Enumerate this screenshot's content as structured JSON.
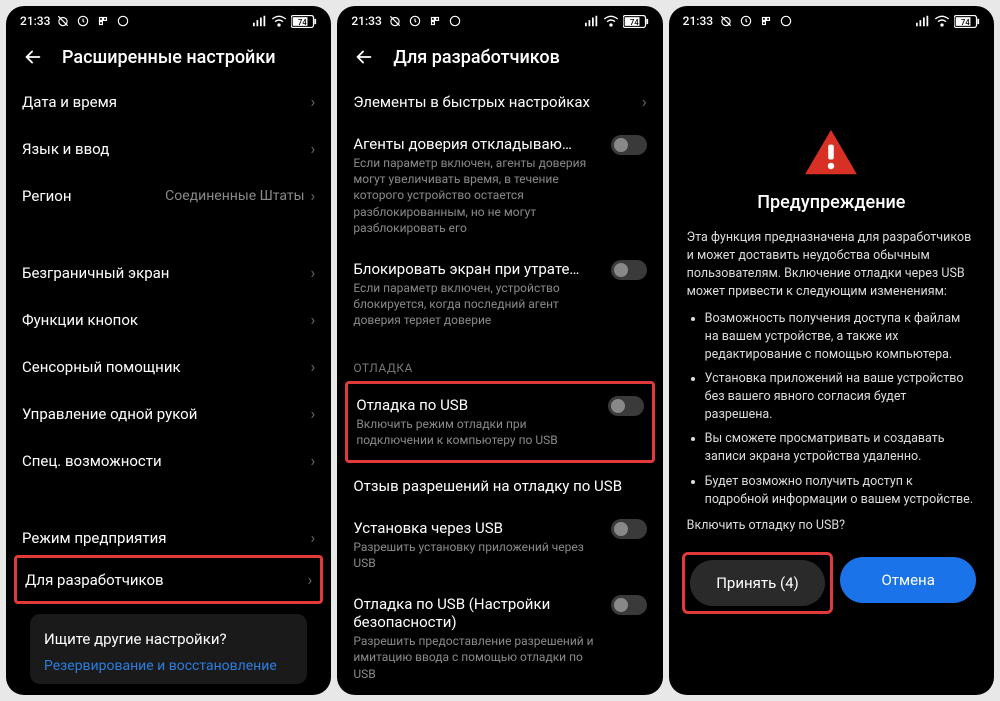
{
  "status": {
    "time": "21:33",
    "battery": "74"
  },
  "phone1": {
    "title": "Расширенные настройки",
    "rows": [
      {
        "ttl": "Дата и время"
      },
      {
        "ttl": "Язык и ввод"
      },
      {
        "ttl": "Регион",
        "val": "Соединенные Штаты"
      }
    ],
    "rows2": [
      {
        "ttl": "Безграничный экран"
      },
      {
        "ttl": "Функции кнопок"
      },
      {
        "ttl": "Сенсорный помощник"
      },
      {
        "ttl": "Управление одной рукой"
      },
      {
        "ttl": "Спец. возможности"
      }
    ],
    "rows3": [
      {
        "ttl": "Режим предприятия"
      },
      {
        "ttl": "Для разработчиков"
      }
    ],
    "foot": {
      "q": "Ищите другие настройки?",
      "link": "Резервирование и восстановление"
    }
  },
  "phone2": {
    "title": "Для разработчиков",
    "quick": "Элементы в быстрых настройках",
    "r1": {
      "ttl": "Агенты доверия откладываю…",
      "sub": "Если параметр включен, агенты доверия могут увеличивать время, в течение которого устройство остается разблокированным, но не могут разблокировать его"
    },
    "r2": {
      "ttl": "Блокировать экран при утрате…",
      "sub": "Если параметр включен, устройство блокируется, когда последний агент доверия теряет доверие"
    },
    "section": "ОТЛАДКА",
    "usb": {
      "ttl": "Отладка по USB",
      "sub": "Включить режим отладки при подключении к компьютеру по USB"
    },
    "r3": {
      "ttl": "Отзыв разрешений на отладку по USB"
    },
    "r4": {
      "ttl": "Установка через USB",
      "sub": "Разрешить установку приложений через USB"
    },
    "r5": {
      "ttl": "Отладка по USB (Настройки безопасности)",
      "sub": "Разрешить предоставление разрешений и имитацию ввода с помощью отладки по USB"
    }
  },
  "phone3": {
    "title": "Предупреждение",
    "intro": "Эта функция предназначена для разработчиков и может доставить неудобства обычным пользователям. Включение отладки через USB может привести к следующим изменениям:",
    "bullets": [
      "Возможность получения доступа к файлам на вашем устройстве, а также их редактирование с помощью компьютера.",
      "Установка приложений на ваше устройство без вашего явного согласия будет разрешена.",
      "Вы сможете просматривать и создавать записи экрана устройства удаленно.",
      "Будет возможно получить доступ к подробной информации о вашем устройстве."
    ],
    "question": "Включить отладку по USB?",
    "accept": "Принять (4)",
    "cancel": "Отмена"
  }
}
